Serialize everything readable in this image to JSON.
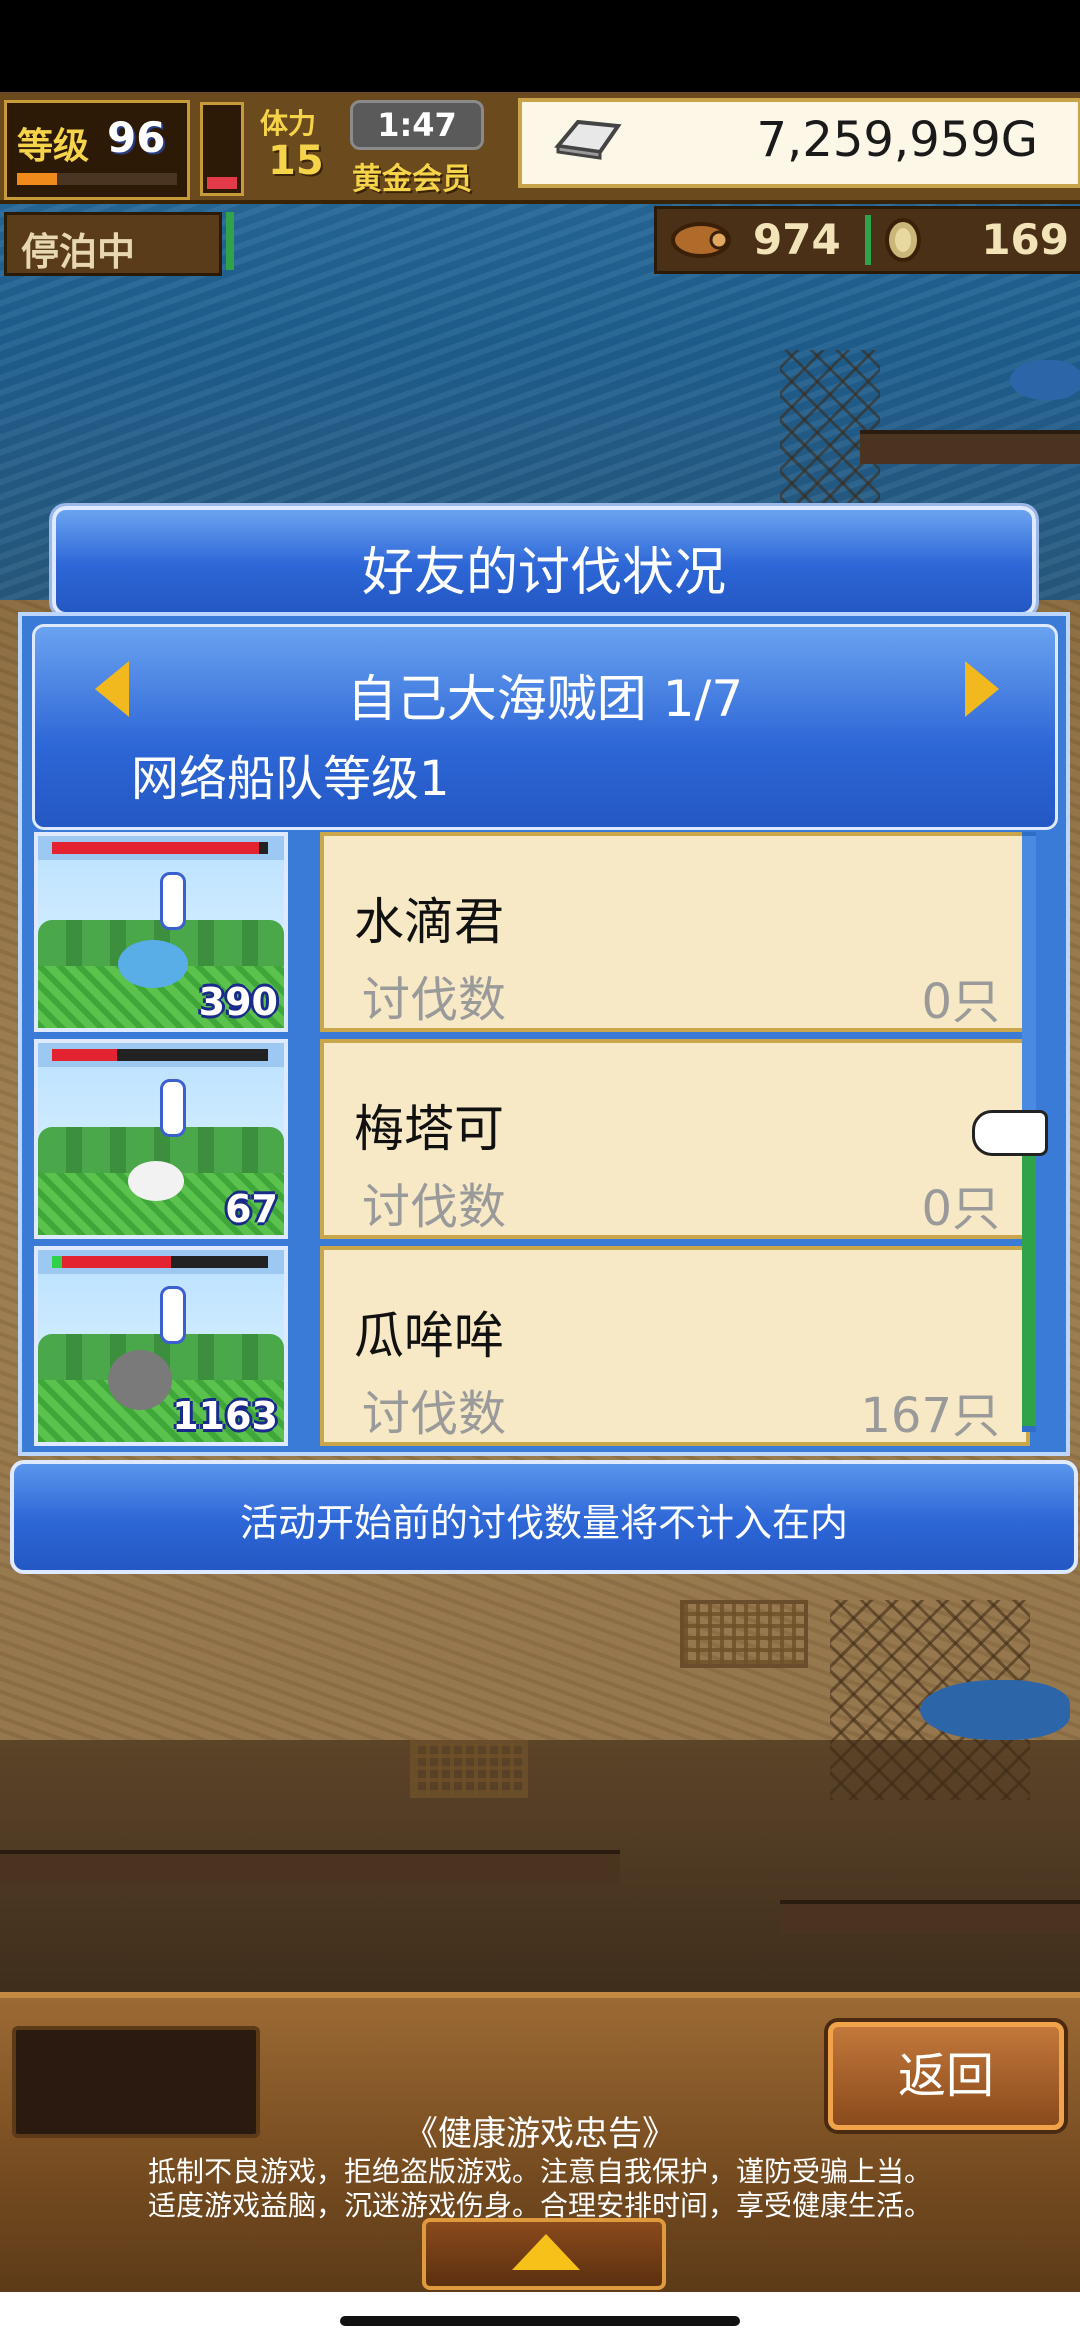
{
  "hud": {
    "level_label": "等级",
    "level": "96",
    "level_progress": 0.25,
    "hp_fraction": 0.15,
    "stamina_label": "体力",
    "stamina": "15",
    "clock": "1:47",
    "membership": "黄金会员",
    "money": "7,259,959G",
    "status": "停泊中",
    "resource_1": "974",
    "resource_2": "169"
  },
  "dialog": {
    "title": "好友的讨伐状况",
    "group": "自己大海贼团 1/7",
    "fleet_level": "网络船队等级1",
    "rows": [
      {
        "name": "水滴君",
        "label": "讨伐数",
        "value": "0只",
        "badge": "390",
        "hp_fraction": 0.96,
        "monster_color": "#5aaee8"
      },
      {
        "name": "梅塔可",
        "label": "讨伐数",
        "value": "0只",
        "badge": "67",
        "hp_fraction": 0.3,
        "monster_color": "#f2f2f2"
      },
      {
        "name": "瓜哞哞",
        "label": "讨伐数",
        "value": "167只",
        "badge": "1163",
        "hp_fraction": 0.55,
        "monster_color": "#7a7a7a"
      }
    ],
    "notice": "活动开始前的讨伐数量将不计入在内"
  },
  "bottom": {
    "back": "返回",
    "health_title": "《健康游戏忠告》",
    "health_line_1": "抵制不良游戏，拒绝盗版游戏。注意自我保护，谨防受骗上当。",
    "health_line_2": "适度游戏益脑，沉迷游戏伤身。合理安排时间，享受健康生活。"
  },
  "icons": {
    "anchor": "anchor-icon",
    "money": "silver-bar-icon",
    "resource_1": "wood-log-icon",
    "resource_2": "coin-icon",
    "prev": "arrow-left-icon",
    "next": "arrow-right-icon",
    "pointer": "hand-pointer-icon",
    "up": "arrow-up-icon"
  }
}
